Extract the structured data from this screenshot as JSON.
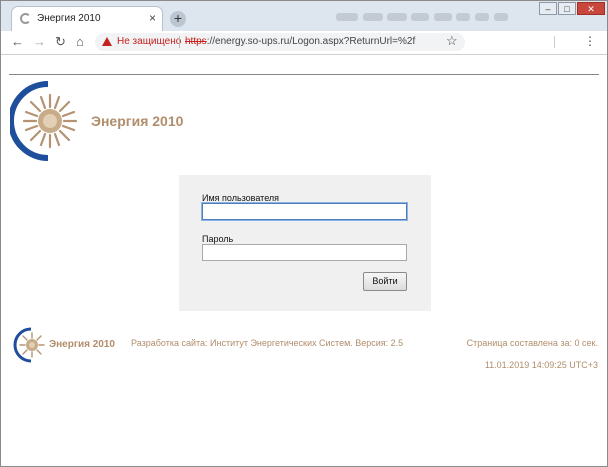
{
  "browser": {
    "tab_title": "Энергия 2010",
    "tab_close": "×",
    "new_tab": "+",
    "security_warning": "Не защищено",
    "url_scheme": "https",
    "url_rest": "://energy.so-ups.ru/Logon.aspx?ReturnUrl=%2f",
    "nav": {
      "back": "←",
      "forward": "→",
      "reload": "↻",
      "home": "⌂"
    },
    "bookmark_star": "☆",
    "menu": "⋮",
    "window_controls": {
      "minimize": "–",
      "maximize": "□",
      "close": "✕"
    }
  },
  "header": {
    "brand": "Энергия 2010"
  },
  "login": {
    "username_label": "Имя пользователя",
    "username_value": "",
    "password_label": "Пароль",
    "password_value": "",
    "submit_label": "Войти"
  },
  "footer": {
    "brand": "Энергия 2010",
    "developer": "Разработка сайта: Институт Энергетических Систем.  Версия: 2.5",
    "render_time": "Страница составлена за: 0 сек.",
    "datetime": "11.01.2019 14:09:25 UTC+3"
  },
  "colors": {
    "brand_text": "#b08d6b",
    "logo_arc": "#1f4e9c",
    "warning": "#c5221f"
  },
  "icons": [
    "back-icon",
    "forward-icon",
    "reload-icon",
    "home-icon",
    "warning-icon",
    "star-icon",
    "menu-icon",
    "logo-sun-icon"
  ]
}
